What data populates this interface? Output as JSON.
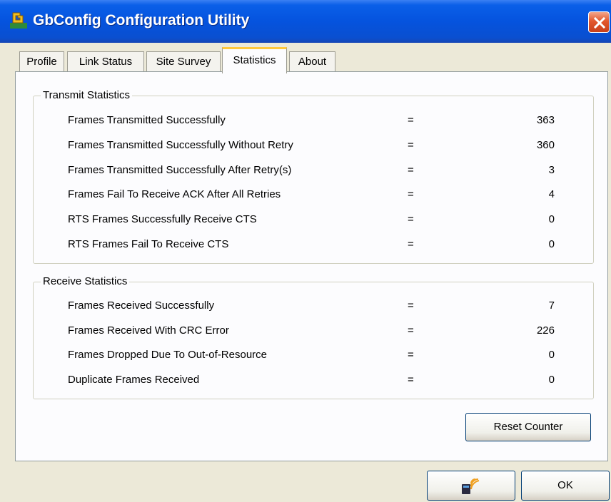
{
  "window": {
    "title": "GbConfig Configuration Utility"
  },
  "tabs": [
    {
      "label": "Profile",
      "active": false
    },
    {
      "label": "Link Status",
      "active": false
    },
    {
      "label": "Site Survey",
      "active": false
    },
    {
      "label": "Statistics",
      "active": true
    },
    {
      "label": "About",
      "active": false
    }
  ],
  "transmit": {
    "title": "Transmit Statistics",
    "rows": [
      {
        "label": "Frames Transmitted Successfully",
        "eq": "=",
        "value": "363"
      },
      {
        "label": "Frames Transmitted Successfully  Without Retry",
        "eq": "=",
        "value": "360"
      },
      {
        "label": "Frames Transmitted Successfully After Retry(s)",
        "eq": "=",
        "value": "3"
      },
      {
        "label": "Frames Fail To Receive ACK After All Retries",
        "eq": "=",
        "value": "4"
      },
      {
        "label": "RTS Frames Successfully Receive CTS",
        "eq": "=",
        "value": "0"
      },
      {
        "label": "RTS Frames Fail To Receive CTS",
        "eq": "=",
        "value": "0"
      }
    ]
  },
  "receive": {
    "title": "Receive Statistics",
    "rows": [
      {
        "label": "Frames Received Successfully",
        "eq": "=",
        "value": "7"
      },
      {
        "label": "Frames Received With CRC Error",
        "eq": "=",
        "value": "226"
      },
      {
        "label": "Frames Dropped Due To Out-of-Resource",
        "eq": "=",
        "value": "0"
      },
      {
        "label": "Duplicate Frames Received",
        "eq": "=",
        "value": "0"
      }
    ]
  },
  "buttons": {
    "reset": "Reset Counter",
    "ok": "OK",
    "wireless_icon": "wireless-card-icon"
  },
  "colors": {
    "titlebar": "#0553de",
    "active_tab_accent": "#ffc83c",
    "close_button": "#e2572d"
  }
}
